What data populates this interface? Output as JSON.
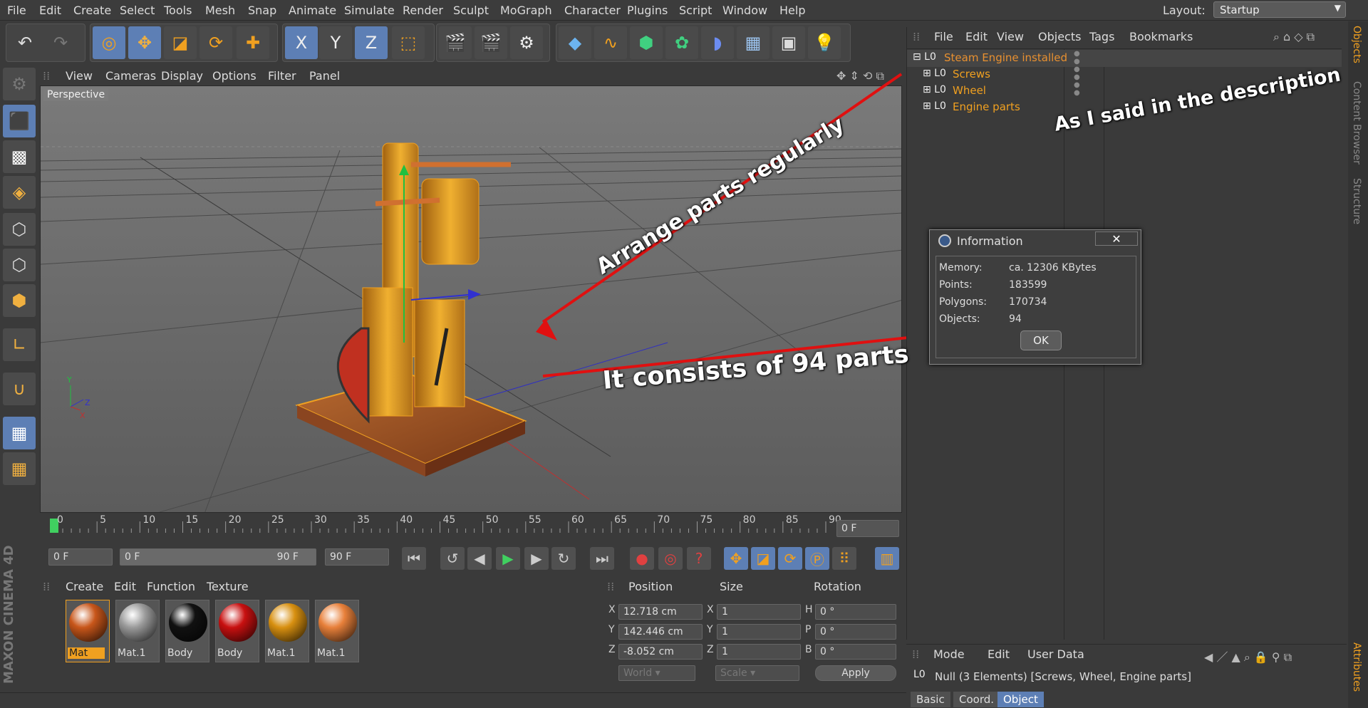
{
  "menubar": {
    "items": [
      "File",
      "Edit",
      "Create",
      "Select",
      "Tools",
      "Mesh",
      "Snap",
      "Animate",
      "Simulate",
      "Render",
      "Sculpt",
      "MoGraph",
      "Character",
      "Plugins",
      "Script",
      "Window",
      "Help"
    ],
    "layout_label": "Layout:",
    "layout_value": "Startup"
  },
  "toolbar": {
    "axis_labels": [
      "X",
      "Y",
      "Z"
    ]
  },
  "viewport": {
    "menu": [
      "View",
      "Cameras",
      "Display",
      "Options",
      "Filter",
      "Panel"
    ],
    "label": "Perspective",
    "axis_gizmo": {
      "y": "Y",
      "x": "X",
      "z": "Z"
    }
  },
  "timeline": {
    "ticks": [
      "0",
      "5",
      "10",
      "15",
      "20",
      "25",
      "30",
      "35",
      "40",
      "45",
      "50",
      "55",
      "60",
      "65",
      "70",
      "75",
      "80",
      "85",
      "90"
    ],
    "current_frame": "0 F"
  },
  "transport": {
    "start": "0 F",
    "range_start": "0 F",
    "range_end": "90 F",
    "end": "90 F"
  },
  "materials": {
    "menu": [
      "Create",
      "Edit",
      "Function",
      "Texture"
    ],
    "items": [
      {
        "name": "Mat",
        "color": "#c8561a"
      },
      {
        "name": "Mat.1",
        "color": "#9a9a9a"
      },
      {
        "name": "Body",
        "color": "#111111"
      },
      {
        "name": "Body",
        "color": "#c81010"
      },
      {
        "name": "Mat.1",
        "color": "#d89010"
      },
      {
        "name": "Mat.1",
        "color": "#e8803a"
      }
    ],
    "brand": "MAXON CINEMA 4D"
  },
  "coords": {
    "headers": [
      "Position",
      "Size",
      "Rotation"
    ],
    "rows": [
      {
        "pl": "X",
        "pv": "12.718 cm",
        "sl": "X",
        "sv": "1",
        "rl": "H",
        "rv": "0 °"
      },
      {
        "pl": "Y",
        "pv": "142.446 cm",
        "sl": "Y",
        "sv": "1",
        "rl": "P",
        "rv": "0 °"
      },
      {
        "pl": "Z",
        "pv": "-8.052 cm",
        "sl": "Z",
        "sv": "1",
        "rl": "B",
        "rv": "0 °"
      }
    ],
    "mode1": "World",
    "mode2": "Scale",
    "apply": "Apply"
  },
  "objects": {
    "menu": [
      "File",
      "Edit",
      "View",
      "Objects",
      "Tags",
      "Bookmarks"
    ],
    "tree": [
      "Steam Engine installed",
      "Screws",
      "Wheel",
      "Engine parts"
    ]
  },
  "attributes": {
    "menu": [
      "Mode",
      "Edit",
      "User Data"
    ],
    "summary": "Null (3 Elements) [Screws, Wheel, Engine parts]",
    "tabs": [
      "Basic",
      "Coord.",
      "Object"
    ]
  },
  "sidetabs": [
    "Objects",
    "Content Browser",
    "Structure",
    "Attributes"
  ],
  "info_dialog": {
    "title": "Information",
    "close": "✕",
    "rows": [
      {
        "label": "Memory:",
        "value": "ca. 12306 KBytes"
      },
      {
        "label": "Points:",
        "value": "183599"
      },
      {
        "label": "Polygons:",
        "value": "170734"
      },
      {
        "label": "Objects:",
        "value": "94"
      }
    ],
    "ok": "OK"
  },
  "annotations": {
    "arrange": "Arrange parts regularly",
    "consists": "It consists of 94 parts",
    "description": "As I said in the description"
  },
  "colors": {
    "accent": "#5d7fb5",
    "object_orange": "#f0a020",
    "annotation_red": "#e01010"
  }
}
